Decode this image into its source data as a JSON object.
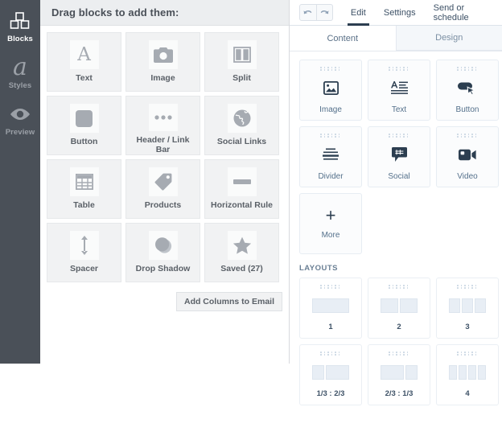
{
  "rail": {
    "items": [
      {
        "label": "Blocks",
        "icon": "blocks-icon",
        "active": true
      },
      {
        "label": "Styles",
        "icon": "letter-a-icon",
        "active": false
      },
      {
        "label": "Preview",
        "icon": "eye-icon",
        "active": false
      }
    ]
  },
  "blocks_panel": {
    "header_title": "Drag blocks to add them:",
    "add_columns_label": "Add Columns to Email",
    "tiles": [
      {
        "label": "Text",
        "icon": "serif-a-icon"
      },
      {
        "label": "Image",
        "icon": "camera-icon"
      },
      {
        "label": "Split",
        "icon": "split-columns-icon"
      },
      {
        "label": "Button",
        "icon": "rounded-square-icon"
      },
      {
        "label": "Header / Link Bar",
        "icon": "three-dots-icon"
      },
      {
        "label": "Social Links",
        "icon": "globe-icon"
      },
      {
        "label": "Table",
        "icon": "table-grid-icon"
      },
      {
        "label": "Products",
        "icon": "price-tag-icon"
      },
      {
        "label": "Horizontal Rule",
        "icon": "horizontal-rule-icon"
      },
      {
        "label": "Spacer",
        "icon": "vertical-arrows-icon"
      },
      {
        "label": "Drop Shadow",
        "icon": "circle-shadow-icon"
      },
      {
        "label": "Saved (27)",
        "icon": "star-icon"
      }
    ]
  },
  "right_panel": {
    "toolbar": {
      "undo_label": "undo-icon",
      "redo_label": "redo-icon",
      "tabs": [
        {
          "label": "Edit",
          "active": true
        },
        {
          "label": "Settings",
          "active": false
        },
        {
          "label": "Send or schedule",
          "active": false
        }
      ]
    },
    "sub_tabs": [
      {
        "label": "Content",
        "active": true
      },
      {
        "label": "Design",
        "active": false
      }
    ],
    "content_tiles": [
      {
        "label": "Image",
        "icon": "picture-icon"
      },
      {
        "label": "Text",
        "icon": "text-lines-icon"
      },
      {
        "label": "Button",
        "icon": "button-cursor-icon"
      },
      {
        "label": "Divider",
        "icon": "divider-icon"
      },
      {
        "label": "Social",
        "icon": "social-chat-icon"
      },
      {
        "label": "Video",
        "icon": "video-camera-icon"
      }
    ],
    "more": {
      "label": "More",
      "icon": "plus-icon"
    },
    "layouts_title": "LAYOUTS",
    "layouts": [
      {
        "label": "1",
        "segments": [
          60
        ]
      },
      {
        "label": "2",
        "segments": [
          29,
          29
        ]
      },
      {
        "label": "3",
        "segments": [
          18,
          18,
          18
        ]
      },
      {
        "label": "1/3 : 2/3",
        "segments": [
          19,
          38
        ]
      },
      {
        "label": "2/3 : 1/3",
        "segments": [
          38,
          19
        ]
      },
      {
        "label": "4",
        "segments": [
          13,
          13,
          13,
          13
        ]
      }
    ]
  },
  "colors": {
    "rail_bg": "#4a5058",
    "panel_header_bg": "#eceef0",
    "tile_bg": "#f1f2f3",
    "accent_dark": "#2c3e50",
    "label_blue": "#54708b"
  }
}
